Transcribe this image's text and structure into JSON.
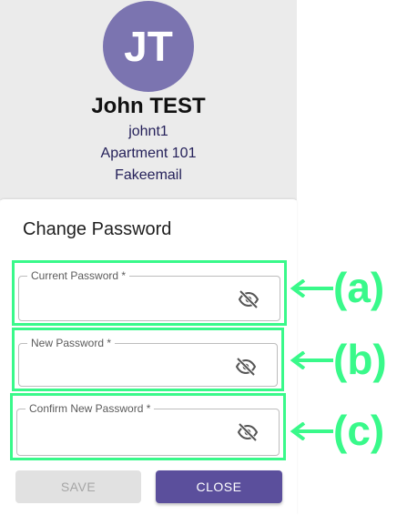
{
  "profile": {
    "initials": "JT",
    "name": "John TEST",
    "username": "johnt1",
    "address": "Apartment 101",
    "email": "Fakeemail"
  },
  "dialog": {
    "title": "Change Password",
    "fields": [
      {
        "label": "Current Password *",
        "value": "",
        "icon": "eye-off-icon"
      },
      {
        "label": "New Password *",
        "value": "",
        "icon": "eye-off-icon"
      },
      {
        "label": "Confirm New Password *",
        "value": "",
        "icon": "eye-off-icon"
      }
    ],
    "save_label": "SAVE",
    "close_label": "CLOSE"
  },
  "annotations": [
    "(a)",
    "(b)",
    "(c)"
  ],
  "colors": {
    "avatar": "#7b74b0",
    "primary": "#5b4f9c",
    "highlight": "#39f98a",
    "panel": "#ebebeb",
    "icon": "#555555"
  }
}
